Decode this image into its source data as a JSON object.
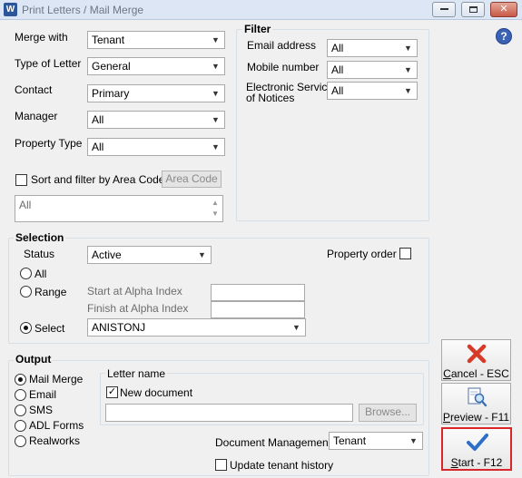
{
  "window": {
    "title": "Print Letters / Mail Merge",
    "app_icon_letter": "W",
    "minimize": "▭",
    "maximize": "▫",
    "close": "✕"
  },
  "help_icon_text": "?",
  "merge": {
    "merge_with_label": "Merge with",
    "merge_with_value": "Tenant",
    "type_label": "Type of Letter",
    "type_value": "General",
    "contact_label": "Contact",
    "contact_value": "Primary",
    "manager_label": "Manager",
    "manager_value": "All",
    "property_type_label": "Property Type",
    "property_type_value": "All",
    "sort_label": "Sort and filter by Area Code",
    "area_code_button": "Area Code",
    "area_list_value": "All"
  },
  "filter": {
    "title": "Filter",
    "email_label": "Email address",
    "email_value": "All",
    "mobile_label": "Mobile number",
    "mobile_value": "All",
    "esn_label_1": "Electronic Service",
    "esn_label_2": "of Notices",
    "esn_value": "All"
  },
  "selection": {
    "title": "Selection",
    "status_label": "Status",
    "status_value": "Active",
    "property_order_label": "Property order",
    "radio_all": "All",
    "radio_range": "Range",
    "radio_select": "Select",
    "start_label": "Start at Alpha Index",
    "finish_label": "Finish at Alpha Index",
    "select_value": "ANISTONJ"
  },
  "output": {
    "title": "Output",
    "options": [
      "Mail Merge",
      "Email",
      "SMS",
      "ADL Forms",
      "Realworks"
    ],
    "letter_name_title": "Letter name",
    "new_document_label": "New document",
    "browse_button": "Browse...",
    "doc_mgmt_label": "Document Management",
    "doc_mgmt_value": "Tenant",
    "update_history_label": "Update tenant history"
  },
  "actions": {
    "cancel_prefix": "C",
    "cancel_rest": "ancel - ESC",
    "preview_prefix": "P",
    "preview_rest": "review - F11",
    "start_prefix": "S",
    "start_rest": "tart - F12"
  },
  "colors": {
    "start_highlight": "#d9262b",
    "cancel_icon": "#d83a2a",
    "start_icon": "#2d6fc8"
  }
}
